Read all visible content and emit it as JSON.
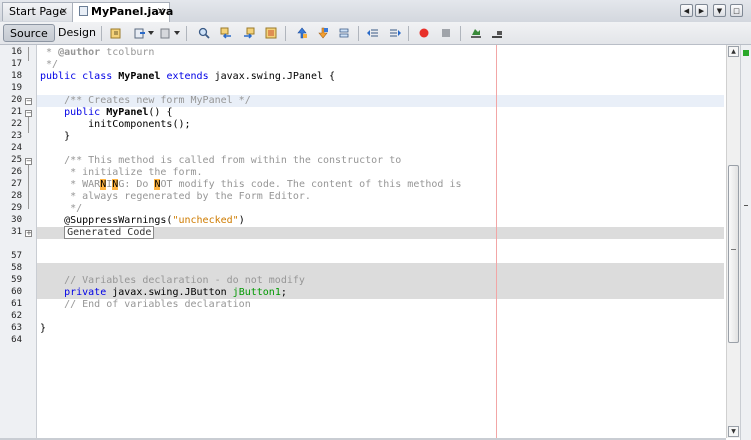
{
  "tabs": [
    {
      "label": "Start Page",
      "close": "×",
      "active": false
    },
    {
      "label": "MyPanel.java",
      "close": "×",
      "active": true
    }
  ],
  "window_controls": [
    "◀",
    "▶",
    "▼",
    "□"
  ],
  "toolbar": {
    "source_label": "Source",
    "design_label": "Design"
  },
  "editor": {
    "lines": [
      {
        "n": "16",
        "parts": [
          [
            "cm",
            " * "
          ],
          [
            "cmb",
            "@author"
          ],
          [
            "cm",
            " tcolburn"
          ]
        ]
      },
      {
        "n": "17",
        "parts": [
          [
            "cm",
            " */"
          ]
        ]
      },
      {
        "n": "18",
        "parts": [
          [
            "kw",
            "public class "
          ],
          [
            "b",
            "MyPanel"
          ],
          [
            "kw",
            " extends "
          ],
          [
            "t",
            "javax.swing.JPanel {"
          ]
        ]
      },
      {
        "n": "19",
        "parts": []
      },
      {
        "n": "20",
        "parts": [
          [
            "cm",
            "    /** Creates new form MyPanel */"
          ]
        ]
      },
      {
        "n": "21",
        "parts": [
          [
            "kw",
            "    public "
          ],
          [
            "b",
            "MyPanel"
          ],
          [
            "t",
            "() {"
          ]
        ]
      },
      {
        "n": "22",
        "parts": [
          [
            "t",
            "        initComponents();"
          ]
        ]
      },
      {
        "n": "23",
        "parts": [
          [
            "t",
            "    }"
          ]
        ]
      },
      {
        "n": "24",
        "parts": []
      },
      {
        "n": "25",
        "parts": [
          [
            "cm",
            "    /** This method is called from within the constructor to"
          ]
        ]
      },
      {
        "n": "26",
        "parts": [
          [
            "cm",
            "     * initialize the form."
          ]
        ]
      },
      {
        "n": "27",
        "parts": [
          [
            "cm",
            "     * WAR"
          ],
          [
            "mk",
            "N"
          ],
          [
            "cm",
            "I"
          ],
          [
            "mk",
            "N"
          ],
          [
            "cm",
            "G: Do "
          ],
          [
            "mk",
            "N"
          ],
          [
            "cm",
            "OT modify this code. The content of this method is"
          ]
        ]
      },
      {
        "n": "28",
        "parts": [
          [
            "cm",
            "     * always regenerated by the Form Editor."
          ]
        ]
      },
      {
        "n": "29",
        "parts": [
          [
            "cm",
            "     */"
          ]
        ]
      },
      {
        "n": "30",
        "parts": [
          [
            "t",
            "    @SuppressWarnings("
          ],
          [
            "str",
            "\"unchecked\""
          ],
          [
            "t",
            ")"
          ]
        ]
      },
      {
        "n": "31",
        "parts": [
          [
            "t",
            "    "
          ],
          [
            "gen",
            "Generated Code"
          ]
        ]
      },
      {
        "n": "57",
        "parts": []
      },
      {
        "n": "58",
        "parts": []
      },
      {
        "n": "59",
        "parts": [
          [
            "cm",
            "    // Variables declaration - do not modify"
          ]
        ]
      },
      {
        "n": "60",
        "parts": [
          [
            "kw",
            "    private "
          ],
          [
            "t",
            "javax.swing.JButton "
          ],
          [
            "fld",
            "jButton1"
          ],
          [
            "t",
            ";"
          ]
        ]
      },
      {
        "n": "61",
        "parts": [
          [
            "cm",
            "    // End of variables declaration"
          ]
        ]
      },
      {
        "n": "62",
        "parts": []
      },
      {
        "n": "63",
        "parts": [
          [
            "t",
            "}"
          ]
        ]
      },
      {
        "n": "64",
        "parts": []
      }
    ]
  },
  "icons": [
    "history-icon",
    "back-icon",
    "forward-icon",
    "find-icon",
    "prev-occurrence-icon",
    "next-occurrence-icon",
    "toggle-highlight-icon",
    "prev-bookmark-icon",
    "next-bookmark-icon",
    "toggle-bookmark-icon",
    "shift-left-icon",
    "shift-right-icon",
    "record-macro-icon",
    "stop-macro-icon",
    "palette-icon",
    "properties-icon"
  ],
  "colors": {
    "keyword": "#0000e6",
    "comment": "#969696",
    "string": "#ce7b00",
    "field": "#009900",
    "error_mark": "#ffb442"
  }
}
